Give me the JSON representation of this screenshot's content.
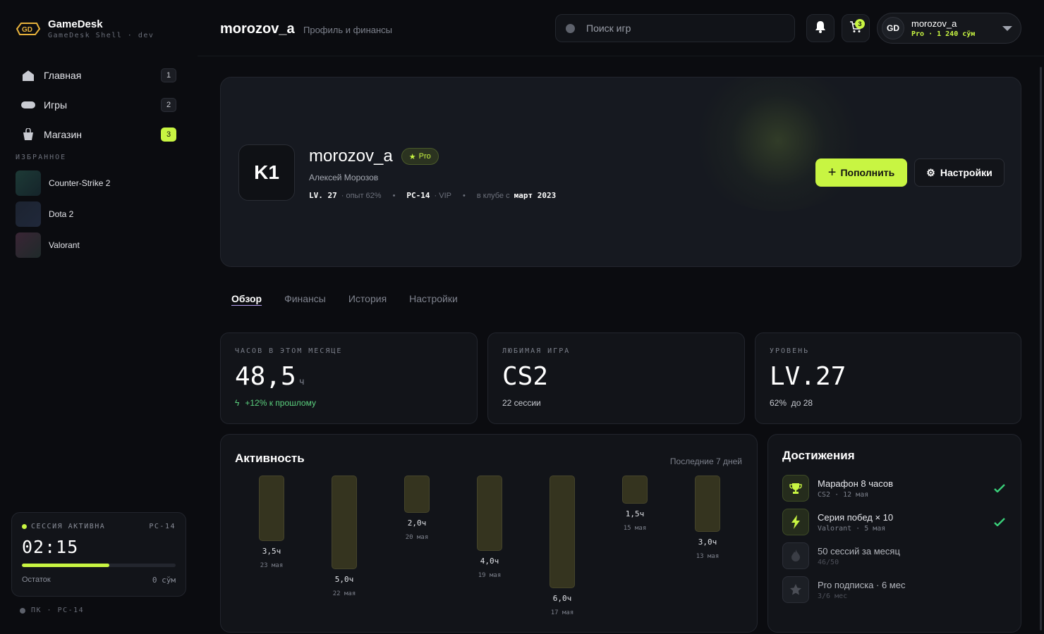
{
  "brand": {
    "name": "GameDesk",
    "sub": "GameDesk Shell · dev"
  },
  "nav": [
    {
      "label": "Главная",
      "badge": "1",
      "icon": "home-icon"
    },
    {
      "label": "Игры",
      "badge": "2",
      "icon": "gamepad-icon"
    },
    {
      "label": "Магазин",
      "badge": "3",
      "icon": "shop-bag-icon"
    }
  ],
  "favorites": {
    "title": "ИЗБРАННОЕ",
    "items": [
      {
        "label": "Counter-Strike 2",
        "color": "#1d3a36"
      },
      {
        "label": "Dota 2",
        "color": "#1c2330"
      },
      {
        "label": "Valorant",
        "color": "#3a2535"
      }
    ]
  },
  "session": {
    "status": "СЕССИЯ АКТИВНА",
    "pc": "PC-14",
    "time": "02:15",
    "progress": 0.57,
    "remaining_label": "Остаток",
    "remaining_value": "0 сўм"
  },
  "footer": {
    "text": "ПК · PC-14"
  },
  "topbar": {
    "title": "morozov_a",
    "subtitle": "Профиль и финансы",
    "search_placeholder": "Поиск игр",
    "cart_count": "3"
  },
  "user": {
    "initials": "GD",
    "name": "morozov_a",
    "meta": "Pro · 1 240 сўм"
  },
  "profile": {
    "avatar": "K1",
    "username": "morozov_a",
    "badge": "Pro",
    "full_name": "Алексей Морозов",
    "level": "LV. 27",
    "xp": "· опыт 62%",
    "pc": "PC-14",
    "pc_tier": "· VIP",
    "since_label": "в клубе с",
    "since_value": "март 2023",
    "topup_label": "Пополнить",
    "settings_label": "Настройки"
  },
  "tabs": [
    "Обзор",
    "Финансы",
    "История",
    "Настройки"
  ],
  "stats": [
    {
      "label": "ЧАСОВ В ЭТОМ МЕСЯЦЕ",
      "value": "48,5",
      "unit": "ч",
      "foot": "+12% к прошлому"
    },
    {
      "label": "ЛЮБИМАЯ ИГРА",
      "value": "CS2",
      "unit": "",
      "foot": "22 сессии"
    },
    {
      "label": "УРОВЕНЬ",
      "value": "LV.27",
      "unit": "",
      "foot": "62%  до 28"
    }
  ],
  "activity": {
    "title": "Активность",
    "range": "Последние 7 дней"
  },
  "chart_data": {
    "type": "bar",
    "categories": [
      "23 мая",
      "22 мая",
      "20 мая",
      "19 мая",
      "17 мая",
      "15 мая",
      "13 мая"
    ],
    "values": [
      3.5,
      5.0,
      2.0,
      4.0,
      6.0,
      1.5,
      3.0
    ],
    "labels": [
      "3,5ч",
      "5,0ч",
      "2,0ч",
      "4,0ч",
      "6,0ч",
      "1,5ч",
      "3,0ч"
    ],
    "ylim": [
      0,
      6
    ]
  },
  "achievements": {
    "title": "Достижения",
    "items": [
      {
        "name": "Марафон 8 часов",
        "sub": "CS2 · 12 мая",
        "done": true,
        "icon": "trophy-icon"
      },
      {
        "name": "Серия побед × 10",
        "sub": "Valorant · 5 мая",
        "done": true,
        "icon": "lightning-icon"
      },
      {
        "name": "50 сессий за месяц",
        "sub": "46/50",
        "done": false,
        "icon": "flame-icon"
      },
      {
        "name": "Pro подписка · 6 мес",
        "sub": "3/6 мес",
        "done": false,
        "icon": "star-icon"
      }
    ]
  },
  "colors": {
    "accent": "#c8f542",
    "bg": "#0b0c10",
    "card": "#121419",
    "positive": "#5bd07e"
  }
}
